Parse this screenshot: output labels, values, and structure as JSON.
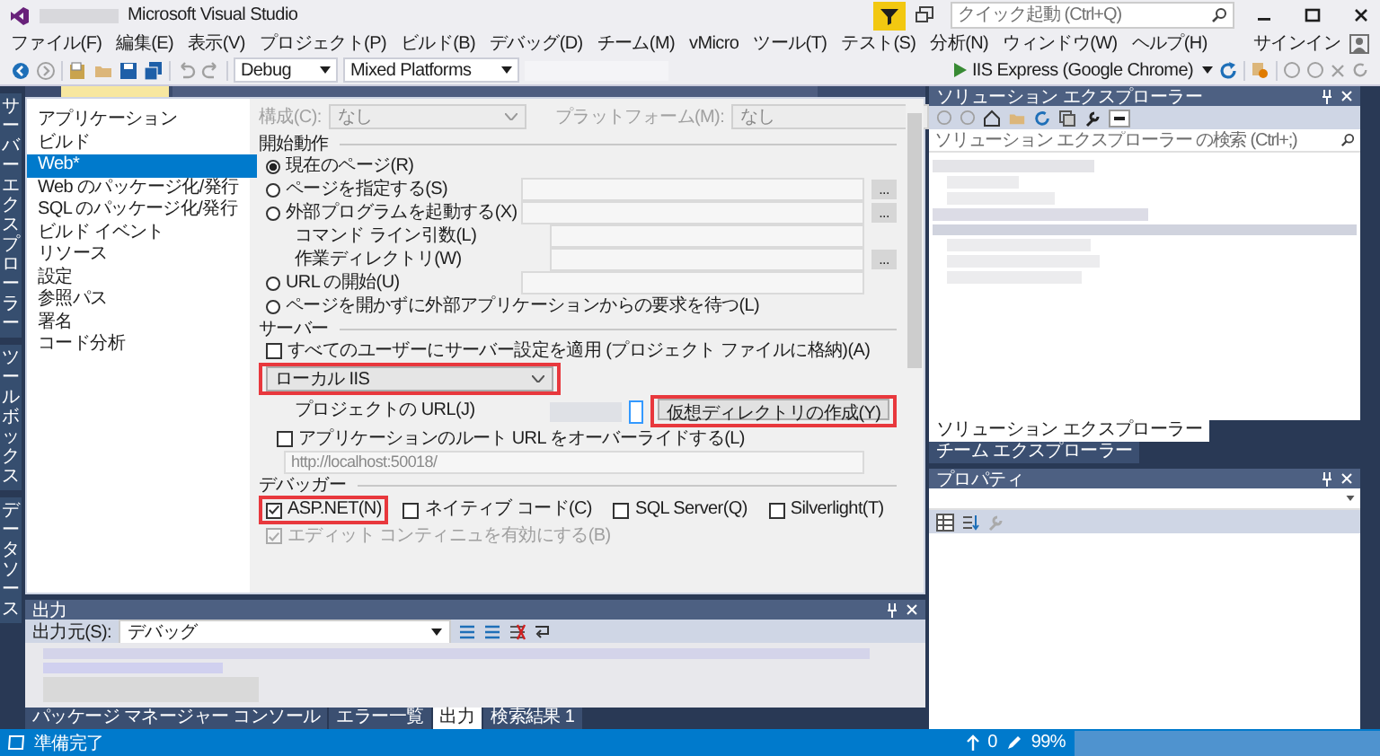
{
  "window": {
    "title": "Microsoft Visual Studio",
    "quick_launch": {
      "placeholder": "クイック起動 (Ctrl+Q)"
    }
  },
  "menu": [
    "ファイル(F)",
    "編集(E)",
    "表示(V)",
    "プロジェクト(P)",
    "ビルド(B)",
    "デバッグ(D)",
    "チーム(M)",
    "vMicro",
    "ツール(T)",
    "テスト(S)",
    "分析(N)",
    "ウィンドウ(W)",
    "ヘルプ(H)"
  ],
  "sign_in": "サインイン",
  "toolbar": {
    "configuration": "Debug",
    "platform": "Mixed Platforms",
    "run_target": "IIS Express (Google Chrome)"
  },
  "left_tabs": [
    "サーバーエクスプローラー",
    "ツールボックス",
    "データソース"
  ],
  "property_nav": [
    {
      "label": "アプリケーション",
      "selected": false
    },
    {
      "label": "ビルド",
      "selected": false
    },
    {
      "label": "Web*",
      "selected": true
    },
    {
      "label": "Web のパッケージ化/発行",
      "selected": false
    },
    {
      "label": "SQL のパッケージ化/発行",
      "selected": false
    },
    {
      "label": "ビルド イベント",
      "selected": false
    },
    {
      "label": "リソース",
      "selected": false
    },
    {
      "label": "設定",
      "selected": false
    },
    {
      "label": "参照パス",
      "selected": false
    },
    {
      "label": "署名",
      "selected": false
    },
    {
      "label": "コード分析",
      "selected": false
    }
  ],
  "config_row": {
    "disabled": true,
    "configuration_label": "構成(C):",
    "configuration": "なし",
    "platform_label": "プラットフォーム(M):",
    "platform": "なし"
  },
  "start_action": {
    "title": "開始動作",
    "options": [
      {
        "kind": "radio",
        "label": "現在のページ(R)",
        "selected": true,
        "field": false
      },
      {
        "kind": "radio",
        "label": "ページを指定する(S)",
        "selected": false,
        "field": true,
        "browse": "..."
      },
      {
        "kind": "radio",
        "label": "外部プログラムを起動する(X)",
        "selected": false,
        "field": true,
        "browse": "..."
      },
      {
        "kind": "label",
        "label": "コマンド ライン引数(L)",
        "field": true
      },
      {
        "kind": "label",
        "label": "作業ディレクトリ(W)",
        "field": true,
        "browse": "..."
      },
      {
        "kind": "radio",
        "label": "URL の開始(U)",
        "selected": false,
        "field": true
      },
      {
        "kind": "radio",
        "label": "ページを開かずに外部アプリケーションからの要求を待つ(L)",
        "selected": false,
        "field": false
      }
    ]
  },
  "server": {
    "title": "サーバー",
    "apply_all": {
      "label": "すべてのユーザーにサーバー設定を適用 (プロジェクト ファイルに格納)(A)",
      "checked": false
    },
    "server_type": {
      "value": "ローカル IIS",
      "highlighted": true
    },
    "project_url_label": "プロジェクトの URL(J)",
    "create_vdir": {
      "label": "仮想ディレクトリの作成(Y)",
      "highlighted": true
    },
    "override": {
      "label": "アプリケーションのルート URL をオーバーライドする(L)",
      "checked": false
    },
    "override_url": "http://localhost:50018/"
  },
  "debuggers": {
    "title": "デバッガー",
    "items": [
      {
        "label": "ASP.NET(N)",
        "checked": true,
        "highlighted": true
      },
      {
        "label": "ネイティブ コード(C)",
        "checked": false,
        "highlighted": false
      },
      {
        "label": "SQL Server(Q)",
        "checked": false,
        "highlighted": false
      },
      {
        "label": "Silverlight(T)",
        "checked": false,
        "highlighted": false
      }
    ],
    "edit_continue": {
      "label": "エディット コンティニュを有効にする(B)",
      "checked": true,
      "disabled": true
    }
  },
  "output": {
    "title": "出力",
    "source_label": "出力元(S):",
    "source": "デバッグ",
    "tabs": [
      {
        "label": "パッケージ マネージャー コンソール",
        "selected": false
      },
      {
        "label": "エラー一覧",
        "selected": false
      },
      {
        "label": "出力",
        "selected": true
      },
      {
        "label": "検索結果 1",
        "selected": false
      }
    ]
  },
  "solution_explorer": {
    "title": "ソリューション エクスプローラー",
    "search_placeholder": "ソリューション エクスプローラー の検索 (Ctrl+;)",
    "tabs": [
      {
        "label": "ソリューション エクスプローラー",
        "selected": true
      },
      {
        "label": "チーム エクスプローラー",
        "selected": false
      }
    ]
  },
  "properties": {
    "title": "プロパティ"
  },
  "status_bar": {
    "message": "準備完了",
    "pending_changes": "0",
    "zoom": "99%"
  }
}
